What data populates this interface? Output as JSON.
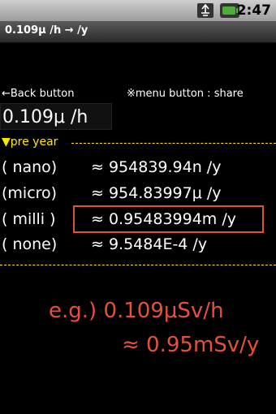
{
  "status_bar": {
    "time": "2:47",
    "icons": [
      "usb-debug-icon",
      "battery-icon"
    ],
    "accent_green": "#4caf3a"
  },
  "title_bar": {
    "title": "0.109μ /h → /y"
  },
  "hints": {
    "back": "←Back button",
    "menu": "※menu button : share"
  },
  "input": {
    "value": "0.109μ /h"
  },
  "section": {
    "label": "▼pre year"
  },
  "rows": [
    {
      "label": "( nano)",
      "value": "≈ 954839.94n /y"
    },
    {
      "label": "(micro)",
      "value": "≈ 954.83997μ /y"
    },
    {
      "label": "(  milli )",
      "value": "≈ 0.95483994m /y"
    },
    {
      "label": "( none)",
      "value": "≈ 9.5484E-4 /y"
    }
  ],
  "annotation": {
    "line1": "e.g.) 0.109μSv/h",
    "line2": "≈ 0.95mSv/y",
    "color": "#e8503e"
  }
}
